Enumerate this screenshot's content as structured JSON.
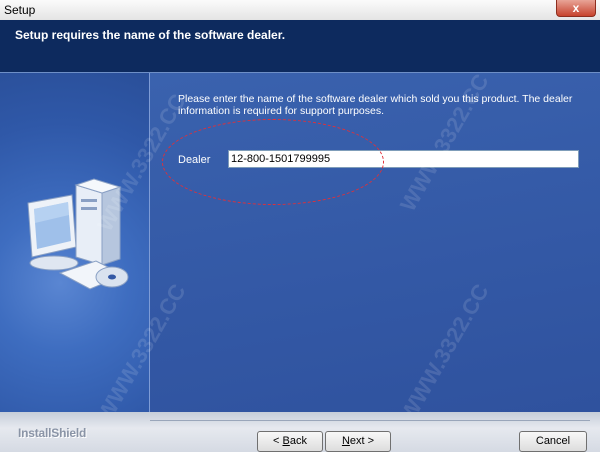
{
  "window": {
    "title": "Setup",
    "close_label": "x"
  },
  "header": {
    "heading": "Setup requires the name of the software dealer."
  },
  "main": {
    "instructions": "Please enter the name of the software dealer which sold you this product.  The dealer information is required for support purposes.",
    "dealer_label": "Dealer",
    "dealer_value": "12-800-1501799995"
  },
  "footer": {
    "brand": "InstallShield",
    "back_prefix": "< ",
    "back_key": "B",
    "back_rest": "ack",
    "next_key": "N",
    "next_rest": "ext >",
    "cancel_label": "Cancel"
  },
  "watermark": {
    "text": "WWW.3322.CC"
  },
  "colors": {
    "header_bg": "#0d2a5e",
    "panel_bg": "#3358a5",
    "highlight": "#e0303a"
  }
}
